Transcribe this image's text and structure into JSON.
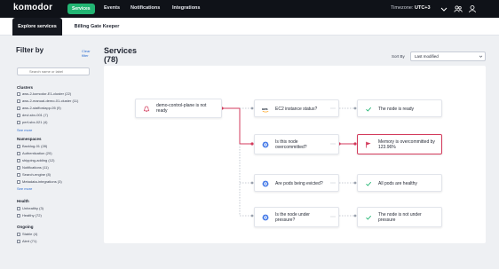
{
  "app": {
    "logo": "komodor",
    "nav": {
      "active_pill": "Services",
      "items": [
        "Events",
        "Notifications",
        "Integrations"
      ]
    },
    "timezone": {
      "label": "Timezone:",
      "value": "UTC+3"
    }
  },
  "tabs": [
    "Explore services",
    "Billing Gate Keeper"
  ],
  "sidebar": {
    "title": "Filter by",
    "clear": "Clear filter",
    "search_placeholder": "Search name or label",
    "sections": [
      {
        "title": "Clusters",
        "options": [
          "aws-2-komodor-E1-cluster (22)",
          "aws-2-manual-demo-01-cluster (11)",
          "aws-2-staffordapp-05 (9)",
          "devl-sbx-001 (7)",
          "perf-sbx-021 (4)"
        ],
        "see_more": "See more"
      },
      {
        "title": "Namespaces",
        "options": [
          "Backlog-01 (28)",
          "Authentication (20)",
          "shipping-adding (12)",
          "Notifications (11)",
          "Search-engine (8)",
          "Metadata-integrations (3)"
        ],
        "see_more": "See more"
      },
      {
        "title": "Health",
        "options": [
          "Unhealthy (3)",
          "Healthy (72)"
        ]
      },
      {
        "title": "Ongoing",
        "options": [
          "Stable (4)",
          "Alert (71)"
        ]
      }
    ]
  },
  "main": {
    "title": "Services",
    "count": "(78)",
    "sort_label": "Sort By",
    "sort_value": "Last modified"
  },
  "flow": {
    "nodes": {
      "root": "demo-control-plane is not ready",
      "ec2": "EC2 instance status?",
      "node_ready": "The node is ready",
      "overcommitted_q": "Is this node overcommitted?",
      "overcommitted_a": "Memory is overcommitted by 123.96%",
      "pods_evicted_q": "Are pods being evicted?",
      "pods_healthy": "All pods are healthy",
      "pressure_q": "Is the node under pressure?",
      "pressure_a": "The node is not under pressure"
    }
  },
  "colors": {
    "brand_green": "#22b573",
    "alert_red": "#d33b5c",
    "link_blue": "#2b6cd0",
    "topbar": "#0f1218"
  }
}
